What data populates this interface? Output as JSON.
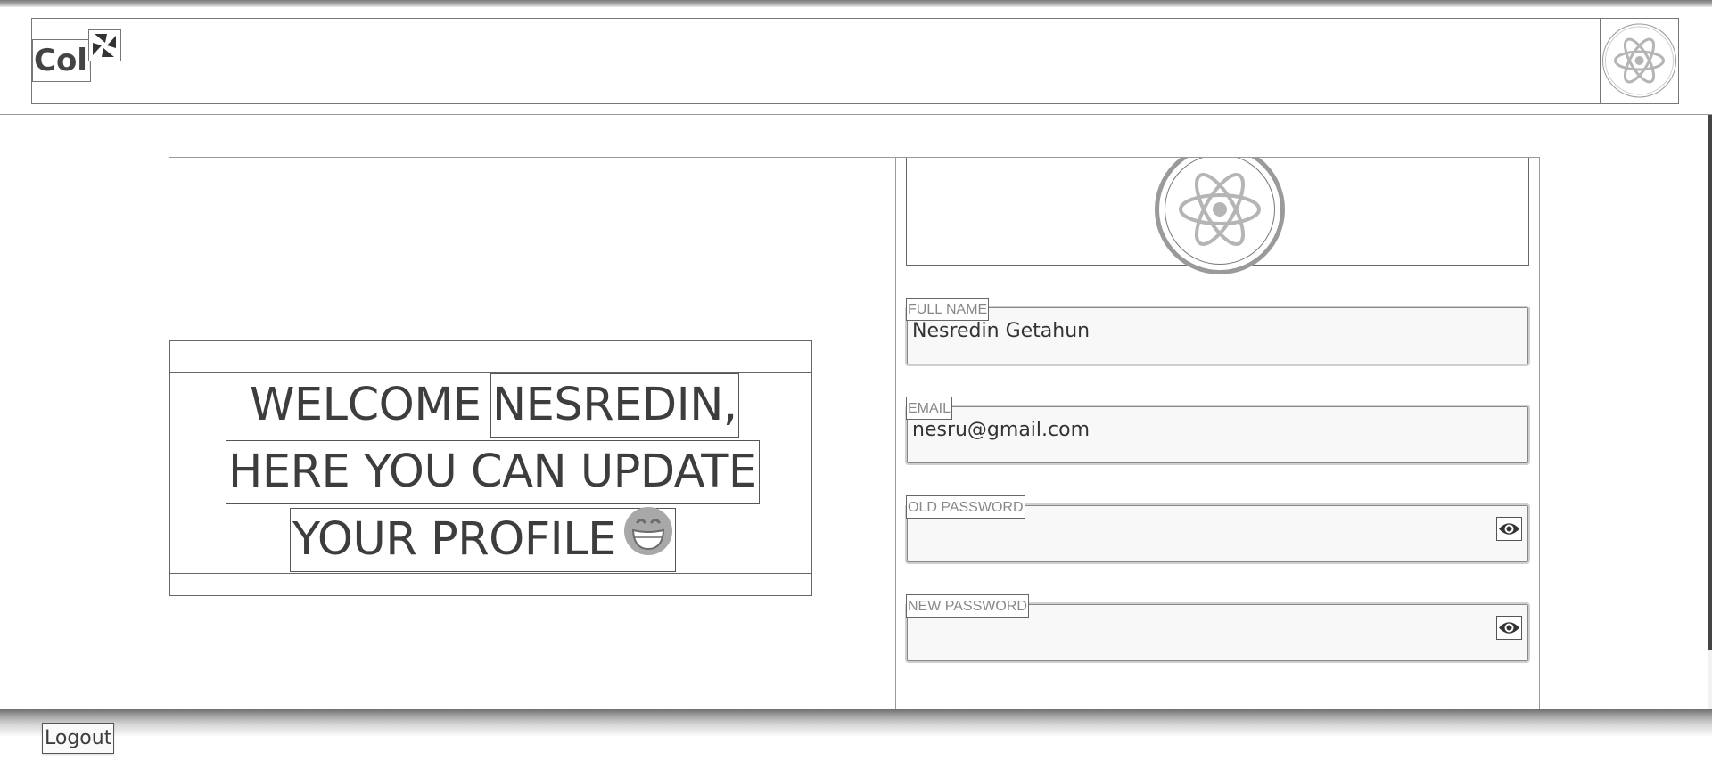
{
  "header": {
    "brand_text": "Coli",
    "brand_icon": "pinwheel-icon",
    "avatar_icon": "react-atom-icon"
  },
  "welcome": {
    "line1_a": "WELCOME",
    "line1_b": "NESREDIN,",
    "line2": "HERE YOU CAN UPDATE",
    "line3": "YOUR PROFILE",
    "emoji": "grinning-face-icon"
  },
  "profile": {
    "avatar_icon": "react-atom-icon",
    "full_name": {
      "label": "FULL NAME",
      "value": "Nesredin Getahun"
    },
    "email": {
      "label": "EMAIL",
      "value": "nesru@gmail.com"
    },
    "old_password": {
      "label": "OLD PASSWORD",
      "value": "",
      "toggle_icon": "eye-icon"
    },
    "new_password": {
      "label": "NEW PASSWORD",
      "value": "",
      "toggle_icon": "eye-icon"
    }
  },
  "footer": {
    "logout_label": "Logout"
  },
  "colors": {
    "text": "#3d3d3d",
    "border": "#777777",
    "input_bg": "#f8f8f8",
    "icon_gray": "#b0b0b0"
  }
}
